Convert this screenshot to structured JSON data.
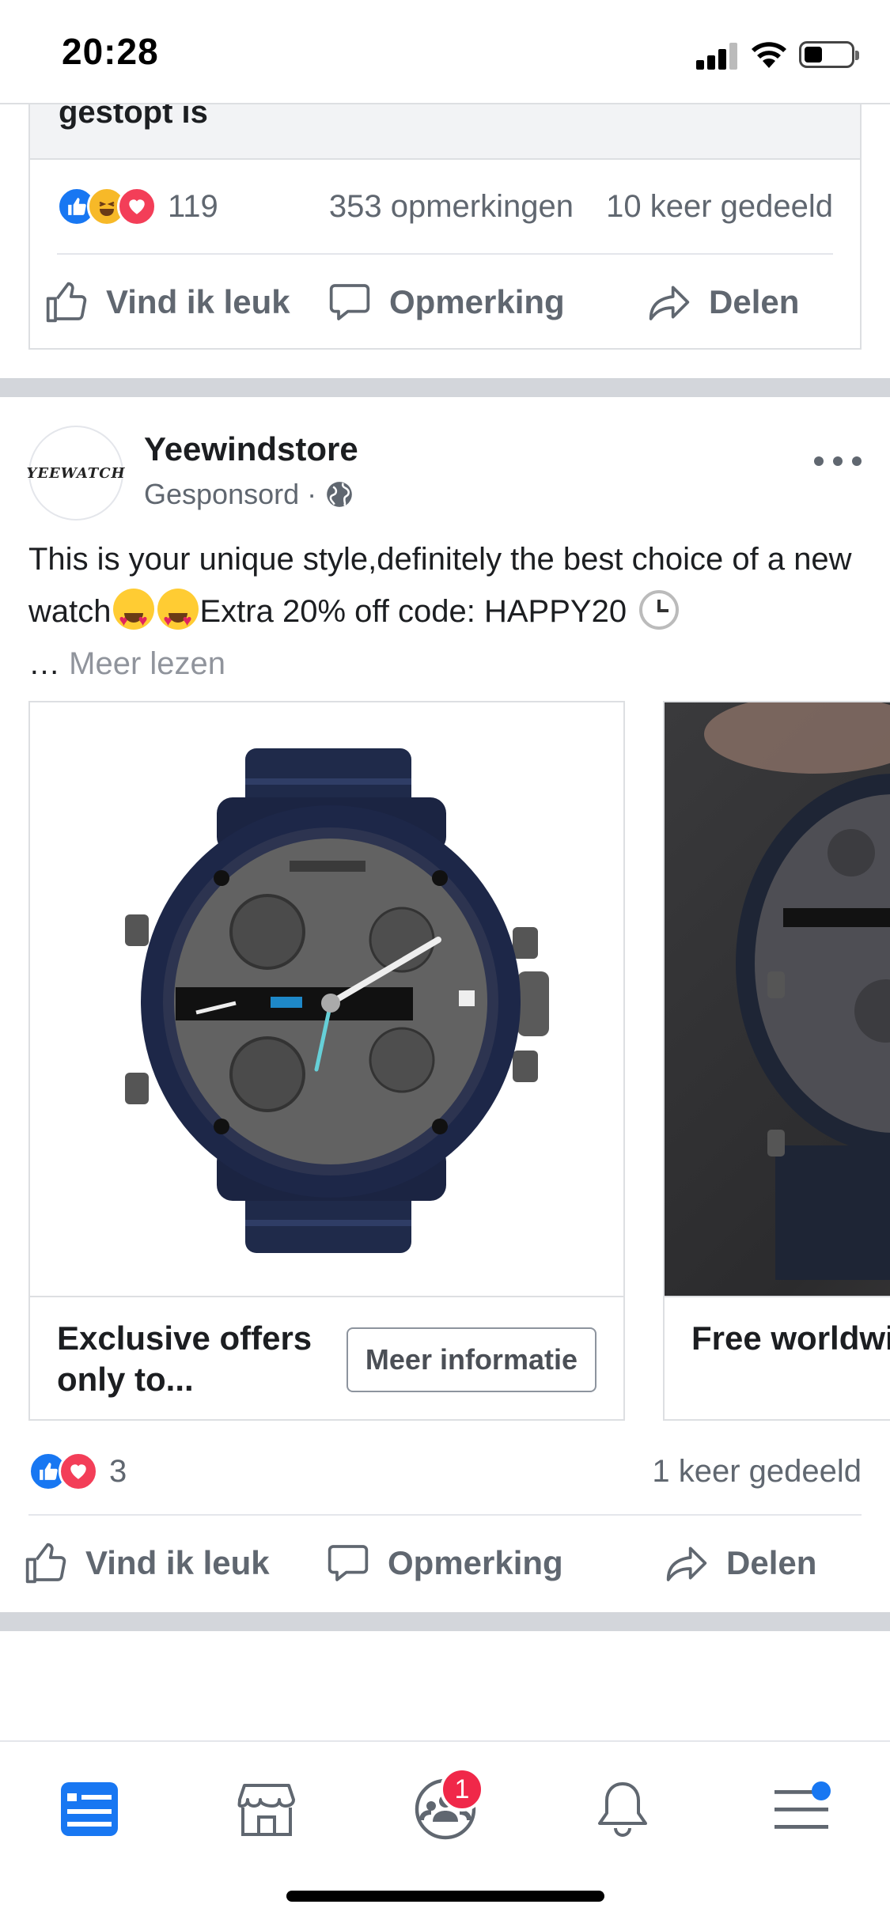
{
  "status_bar": {
    "time": "20:28",
    "battery_level": 0.35
  },
  "previous_post": {
    "text_tail": "gestopt is",
    "reaction_count": "119",
    "comments": "353 opmerkingen",
    "shares": "10 keer gedeeld",
    "reaction_icons": [
      "like-icon",
      "haha-icon",
      "love-icon"
    ],
    "actions": {
      "like": "Vind ik leuk",
      "comment": "Opmerking",
      "share": "Delen"
    }
  },
  "sponsored_post": {
    "page_name": "Yeewindstore",
    "avatar_text": "YEEWATCH",
    "meta": "Gesponsord",
    "body_part1": "This is your unique style,definitely the best choice of a new watch",
    "body_part2": "Extra 20% off code: HAPPY20",
    "body_ellipsis": "…",
    "read_more": "Meer lezen",
    "cards": [
      {
        "caption": "Exclusive offers only to...",
        "cta": "Meer informatie",
        "image": "watch-product-photo"
      },
      {
        "caption": "Free worldwide shipping",
        "image": "watch-lifestyle-photo"
      }
    ],
    "reaction_count": "3",
    "shares": "1 keer gedeeld",
    "reaction_icons": [
      "like-icon",
      "love-icon"
    ],
    "actions": {
      "like": "Vind ik leuk",
      "comment": "Opmerking",
      "share": "Delen"
    }
  },
  "tab_bar": {
    "tabs": [
      {
        "name": "news-feed",
        "icon": "news-feed-icon",
        "active": true
      },
      {
        "name": "marketplace",
        "icon": "marketplace-icon"
      },
      {
        "name": "groups",
        "icon": "groups-icon",
        "badge": "1"
      },
      {
        "name": "notifications",
        "icon": "bell-icon"
      },
      {
        "name": "menu",
        "icon": "menu-icon",
        "dot": true
      }
    ]
  },
  "colors": {
    "brand_blue": "#1877f2",
    "text_secondary": "#606770",
    "badge_red": "#f02849"
  }
}
